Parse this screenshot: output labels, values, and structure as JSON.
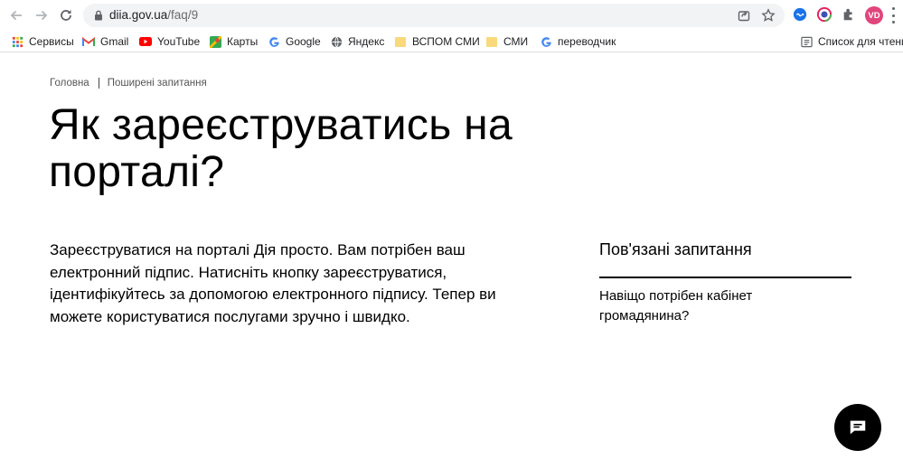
{
  "browser": {
    "url_host": "diia.gov.ua",
    "url_path": "/faq/9",
    "avatar_initials": "VD"
  },
  "bookmarks": [
    {
      "label": "Сервисы",
      "icon": "apps-grid-icon"
    },
    {
      "label": "Gmail",
      "icon": "gmail-icon"
    },
    {
      "label": "YouTube",
      "icon": "youtube-icon"
    },
    {
      "label": "Карты",
      "icon": "maps-icon"
    },
    {
      "label": "Google",
      "icon": "google-icon"
    },
    {
      "label": "Яндекс",
      "icon": "globe-icon"
    },
    {
      "label": "ВСПОМ СМИ",
      "icon": "folder-icon"
    },
    {
      "label": "СМИ",
      "icon": "folder-icon"
    },
    {
      "label": "переводчик",
      "icon": "google-icon"
    }
  ],
  "reading_list": {
    "label": "Список для чтения",
    "icon": "reading-list-icon"
  },
  "breadcrumb": {
    "home": "Головна",
    "current": "Поширені запитання"
  },
  "page": {
    "title": "Як зареєструватись на порталі?",
    "answer": "Зареєструватися на порталі Дія просто. Вам потрібен ваш електронний підпис. Натисніть кнопку зареєструватися, ідентифікуйтесь за допомогою електронного підпису. Тепер ви можете користуватися послугами зручно і швидко."
  },
  "related": {
    "title": "Пов'язані запитання",
    "items": [
      "Навіщо потрібен кабінет громадянина?"
    ]
  },
  "colors": {
    "accent": "#000000",
    "omnibox_bg": "#f1f3f4",
    "avatar_bg": "#e0457b",
    "folder": "#fad97c"
  }
}
